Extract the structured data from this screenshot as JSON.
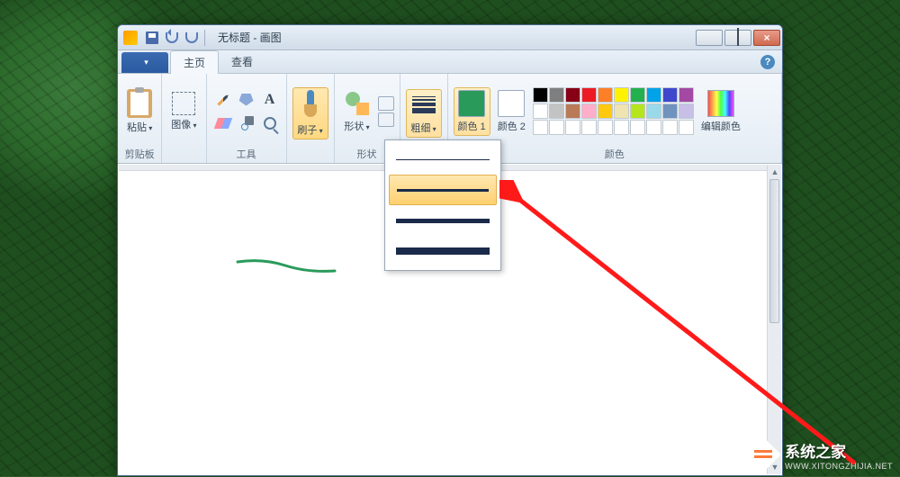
{
  "window": {
    "title": "无标题 - 画图"
  },
  "menu": {
    "file": "",
    "tabs": [
      "主页",
      "查看"
    ],
    "active_tab": 0
  },
  "ribbon": {
    "clipboard": {
      "label": "剪贴板",
      "btn": "粘贴"
    },
    "image": {
      "label": "图像"
    },
    "tools": {
      "label": "工具"
    },
    "brush": {
      "label": "刷子"
    },
    "shapes": {
      "label": "形状",
      "btn": "形状"
    },
    "size": {
      "label": "粗细"
    },
    "colors": {
      "label": "颜色",
      "c1": "颜色 1",
      "c2": "颜色 2",
      "edit": "编辑颜色",
      "palette": [
        "#000000",
        "#7f7f7f",
        "#880015",
        "#ed1c24",
        "#ff7f27",
        "#fff200",
        "#22b14c",
        "#00a2e8",
        "#3f48cc",
        "#a349a4",
        "#ffffff",
        "#c3c3c3",
        "#b97a57",
        "#ffaec9",
        "#ffc90e",
        "#efe4b0",
        "#b5e61d",
        "#99d9ea",
        "#7092be",
        "#c8bfe7",
        "#ffffff",
        "#ffffff",
        "#ffffff",
        "#ffffff",
        "#ffffff",
        "#ffffff",
        "#ffffff",
        "#ffffff",
        "#ffffff",
        "#ffffff"
      ]
    }
  },
  "size_dropdown": {
    "selected": 1,
    "thicknesses": [
      1,
      3,
      5,
      8
    ]
  },
  "watermark": {
    "text": "系统之家",
    "sub": "WWW.XITONGZHIJIA.NET"
  }
}
